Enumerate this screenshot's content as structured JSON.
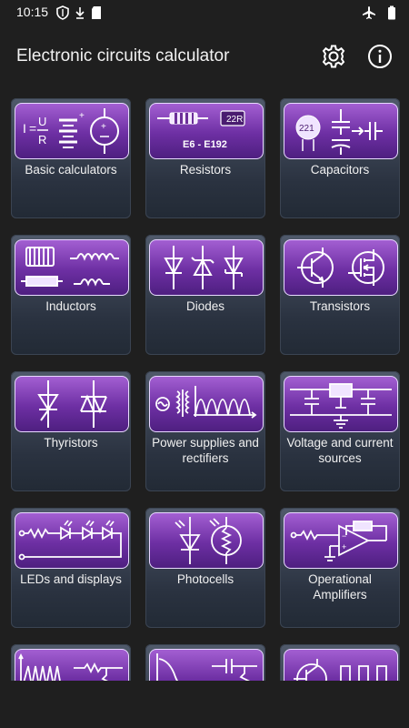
{
  "status": {
    "time": "10:15"
  },
  "app": {
    "title": "Electronic circuits calculator"
  },
  "icons": {
    "settings": "gear-icon",
    "info": "info-icon"
  },
  "categories": [
    {
      "label": "Basic calculators"
    },
    {
      "label": "Resistors",
      "thumb_text": "E6 - E192",
      "chip": "22R"
    },
    {
      "label": "Capacitors",
      "chip": "221"
    },
    {
      "label": "Inductors"
    },
    {
      "label": "Diodes"
    },
    {
      "label": "Transistors"
    },
    {
      "label": "Thyristors"
    },
    {
      "label": "Power supplies and rectifiers"
    },
    {
      "label": "Voltage and current sources"
    },
    {
      "label": "LEDs and displays"
    },
    {
      "label": "Photocells"
    },
    {
      "label": "Operational Amplifiers"
    },
    {
      "label": ""
    },
    {
      "label": ""
    },
    {
      "label": ""
    }
  ],
  "formula": {
    "i": "I",
    "eq": "=",
    "u": "U",
    "r": "R"
  },
  "colors": {
    "background": "#1f1f1f",
    "thumb_top": "#a35fd2",
    "thumb_bottom": "#4e1f80",
    "card_top": "#505a6b",
    "card_bottom": "#222a35"
  }
}
